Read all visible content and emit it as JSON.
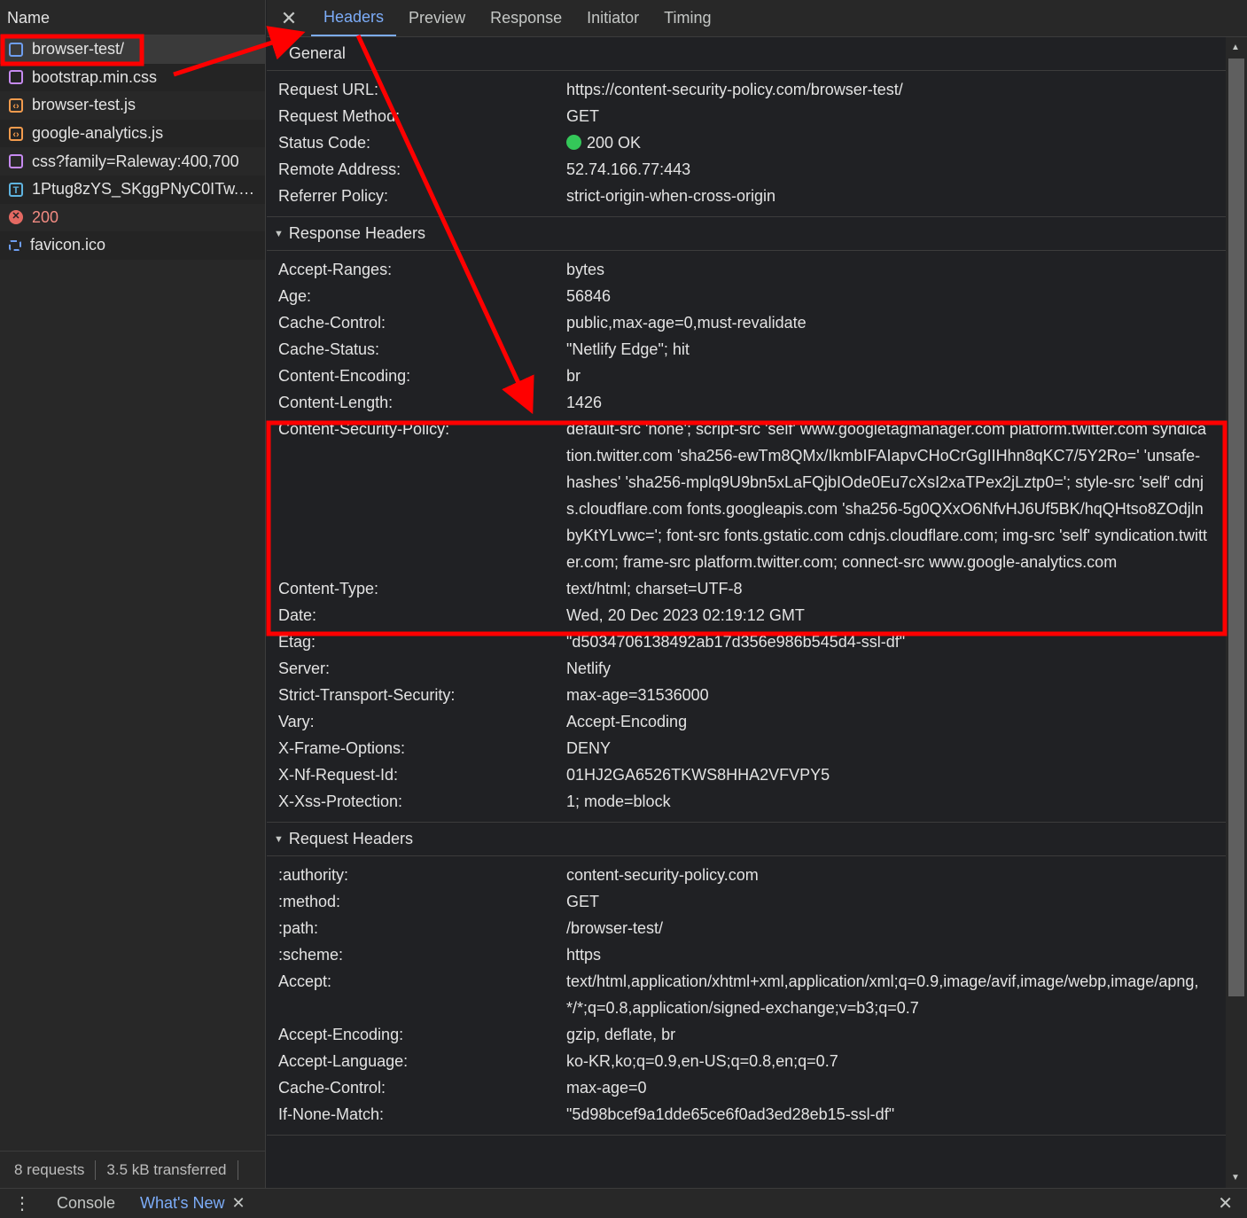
{
  "left_panel": {
    "column_header": "Name",
    "requests": [
      {
        "name": "browser-test/",
        "icon": "document-icon"
      },
      {
        "name": "bootstrap.min.css",
        "icon": "stylesheet-icon"
      },
      {
        "name": "browser-test.js",
        "icon": "script-icon"
      },
      {
        "name": "google-analytics.js",
        "icon": "script-icon"
      },
      {
        "name": "css?family=Raleway:400,700",
        "icon": "stylesheet-icon"
      },
      {
        "name": "1Ptug8zYS_SKggPNyC0ITw.wof...",
        "icon": "font-icon"
      },
      {
        "name": "200",
        "icon": "error-icon"
      },
      {
        "name": "favicon.ico",
        "icon": "image-icon"
      }
    ],
    "status": {
      "requests": "8 requests",
      "transferred": "3.5 kB transferred"
    }
  },
  "tabs": [
    "Headers",
    "Preview",
    "Response",
    "Initiator",
    "Timing"
  ],
  "active_tab": "Headers",
  "sections": {
    "general": {
      "title": "General",
      "rows": [
        {
          "k": "Request URL:",
          "v": "https://content-security-policy.com/browser-test/"
        },
        {
          "k": "Request Method:",
          "v": "GET"
        },
        {
          "k": "Status Code:",
          "v": "200 OK"
        },
        {
          "k": "Remote Address:",
          "v": "52.74.166.77:443"
        },
        {
          "k": "Referrer Policy:",
          "v": "strict-origin-when-cross-origin"
        }
      ]
    },
    "response": {
      "title": "Response Headers",
      "rows": [
        {
          "k": "Accept-Ranges:",
          "v": "bytes"
        },
        {
          "k": "Age:",
          "v": "56846"
        },
        {
          "k": "Cache-Control:",
          "v": "public,max-age=0,must-revalidate"
        },
        {
          "k": "Cache-Status:",
          "v": "\"Netlify Edge\"; hit"
        },
        {
          "k": "Content-Encoding:",
          "v": "br"
        },
        {
          "k": "Content-Length:",
          "v": "1426"
        },
        {
          "k": "Content-Security-Policy:",
          "v": "default-src 'none'; script-src 'self' www.googletagmanager.com platform.twitter.com syndication.twitter.com 'sha256-ewTm8QMx/IkmbIFAIapvCHoCrGgIIHhn8qKC7/5Y2Ro=' 'unsafe-hashes' 'sha256-mplq9U9bn5xLaFQjbIOde0Eu7cXsI2xaTPex2jLztp0='; style-src 'self' cdnjs.cloudflare.com fonts.googleapis.com 'sha256-5g0QXxO6NfvHJ6Uf5BK/hqQHtso8ZOdjlnbyKtYLvwc='; font-src fonts.gstatic.com cdnjs.cloudflare.com; img-src 'self' syndication.twitter.com; frame-src platform.twitter.com; connect-src www.google-analytics.com"
        },
        {
          "k": "Content-Type:",
          "v": "text/html; charset=UTF-8"
        },
        {
          "k": "Date:",
          "v": "Wed, 20 Dec 2023 02:19:12 GMT"
        },
        {
          "k": "Etag:",
          "v": "\"d5034706138492ab17d356e986b545d4-ssl-df\""
        },
        {
          "k": "Server:",
          "v": "Netlify"
        },
        {
          "k": "Strict-Transport-Security:",
          "v": "max-age=31536000"
        },
        {
          "k": "Vary:",
          "v": "Accept-Encoding"
        },
        {
          "k": "X-Frame-Options:",
          "v": "DENY"
        },
        {
          "k": "X-Nf-Request-Id:",
          "v": "01HJ2GA6526TKWS8HHA2VFVPY5"
        },
        {
          "k": "X-Xss-Protection:",
          "v": "1; mode=block"
        }
      ]
    },
    "request": {
      "title": "Request Headers",
      "rows": [
        {
          "k": ":authority:",
          "v": "content-security-policy.com"
        },
        {
          "k": ":method:",
          "v": "GET"
        },
        {
          "k": ":path:",
          "v": "/browser-test/"
        },
        {
          "k": ":scheme:",
          "v": "https"
        },
        {
          "k": "Accept:",
          "v": "text/html,application/xhtml+xml,application/xml;q=0.9,image/avif,image/webp,image/apng,*/*;q=0.8,application/signed-exchange;v=b3;q=0.7"
        },
        {
          "k": "Accept-Encoding:",
          "v": "gzip, deflate, br"
        },
        {
          "k": "Accept-Language:",
          "v": "ko-KR,ko;q=0.9,en-US;q=0.8,en;q=0.7"
        },
        {
          "k": "Cache-Control:",
          "v": "max-age=0"
        },
        {
          "k": "If-None-Match:",
          "v": "\"5d98bcef9a1dde65ce6f0ad3ed28eb15-ssl-df\""
        }
      ]
    }
  },
  "drawer": {
    "tabs": [
      "Console",
      "What's New"
    ],
    "active": "What's New"
  },
  "colors": {
    "accent": "#7cacf8",
    "annotation": "#ff0000",
    "status_ok": "#34c759"
  }
}
